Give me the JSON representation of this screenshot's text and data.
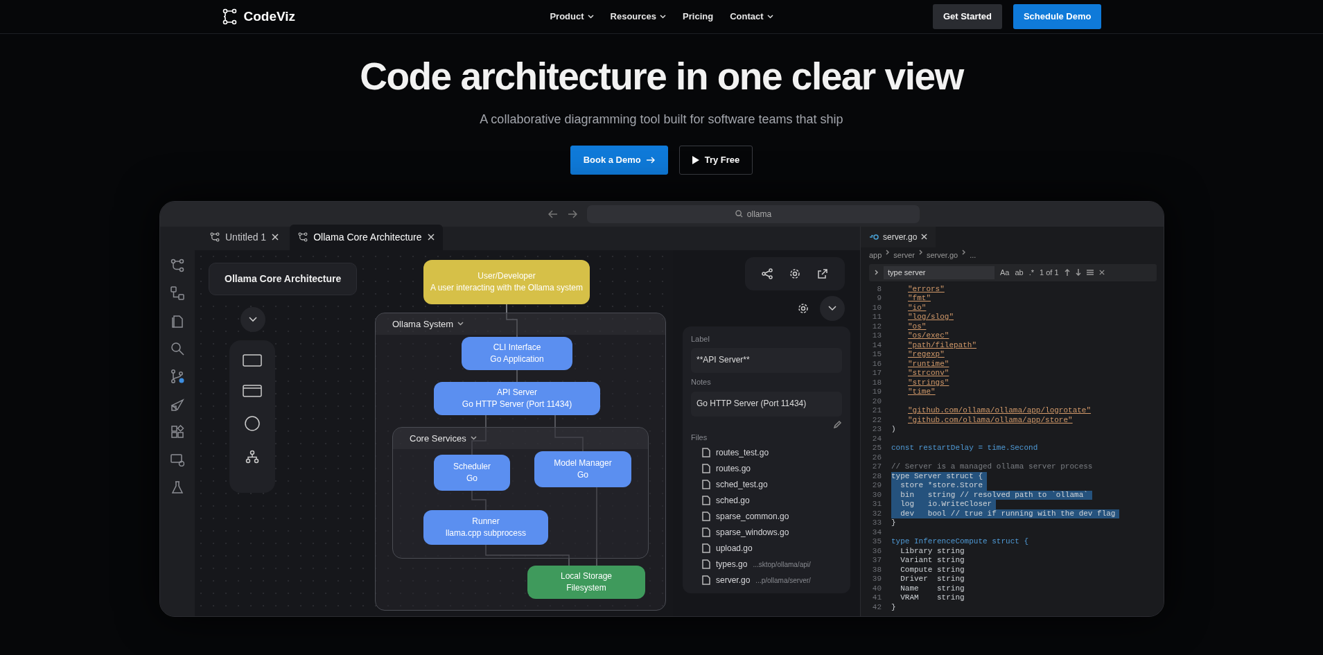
{
  "nav": {
    "brand": "CodeViz",
    "links": [
      {
        "label": "Product",
        "dropdown": true
      },
      {
        "label": "Resources",
        "dropdown": true
      },
      {
        "label": "Pricing",
        "dropdown": false
      },
      {
        "label": "Contact",
        "dropdown": true
      }
    ],
    "buttons": [
      {
        "label": "Get Started",
        "kind": "secondary"
      },
      {
        "label": "Schedule Demo",
        "kind": "primary"
      }
    ]
  },
  "hero": {
    "title": "Code architecture in one clear view",
    "subtitle": "A collaborative diagramming tool built for software teams that ship",
    "buttons": [
      {
        "label": "Book a Demo",
        "kind": "primary"
      },
      {
        "label": "Try Free",
        "kind": "outline"
      }
    ]
  },
  "app": {
    "search": "ollama",
    "tabs": [
      {
        "label": "Untitled 1",
        "selected": false
      },
      {
        "label": "Ollama Core Architecture",
        "selected": true
      }
    ],
    "diagram_title": "Ollama Core Architecture",
    "groups": [
      {
        "label": "Ollama System"
      },
      {
        "label": "Core Services"
      }
    ],
    "nodes": [
      {
        "title": "User/Developer",
        "subtitle": "A user interacting with the Ollama system",
        "color": "#d6c048"
      },
      {
        "title": "CLI Interface",
        "subtitle": "Go Application",
        "color": "#5b8ff0"
      },
      {
        "title": "API Server",
        "subtitle": "Go HTTP Server (Port 11434)",
        "color": "#5b8ff0"
      },
      {
        "title": "Scheduler",
        "subtitle": "Go",
        "color": "#5b8ff0"
      },
      {
        "title": "Model Manager",
        "subtitle": "Go",
        "color": "#5b8ff0"
      },
      {
        "title": "Runner",
        "subtitle": "llama.cpp subprocess",
        "color": "#5b8ff0"
      },
      {
        "title": "Local Storage",
        "subtitle": "Filesystem",
        "color": "#3f9a5c"
      }
    ],
    "properties": {
      "label_caption": "Label",
      "label_value": "**API Server**",
      "notes_caption": "Notes",
      "notes_value": "Go HTTP Server (Port 11434)",
      "files_caption": "Files",
      "files": [
        {
          "name": "routes_test.go"
        },
        {
          "name": "routes.go"
        },
        {
          "name": "sched_test.go"
        },
        {
          "name": "sched.go"
        },
        {
          "name": "sparse_common.go"
        },
        {
          "name": "sparse_windows.go"
        },
        {
          "name": "upload.go"
        },
        {
          "name": "types.go",
          "path": "...sktop/ollama/api/"
        },
        {
          "name": "server.go",
          "path": "...p/ollama/server/"
        }
      ]
    },
    "editor": {
      "tab": "server.go",
      "breadcrumb": [
        "app",
        "server",
        "server.go",
        "..."
      ],
      "find": "type server",
      "find_options": [
        "Aa",
        "ab",
        ".*"
      ],
      "find_count": "1 of 1",
      "lines": [
        {
          "n": "8",
          "code": "\"errors\"",
          "kind": "string",
          "highlighted": false
        },
        {
          "n": "9",
          "code": "\"fmt\"",
          "kind": "string",
          "highlighted": false
        },
        {
          "n": "10",
          "code": "\"io\"",
          "kind": "string",
          "highlighted": false
        },
        {
          "n": "11",
          "code": "\"log/slog\"",
          "kind": "string",
          "highlighted": false
        },
        {
          "n": "12",
          "code": "\"os\"",
          "kind": "string",
          "highlighted": false
        },
        {
          "n": "13",
          "code": "\"os/exec\"",
          "kind": "string",
          "highlighted": false
        },
        {
          "n": "14",
          "code": "\"path/filepath\"",
          "kind": "string",
          "highlighted": false
        },
        {
          "n": "15",
          "code": "\"regexp\"",
          "kind": "string",
          "highlighted": false
        },
        {
          "n": "16",
          "code": "\"runtime\"",
          "kind": "string",
          "highlighted": false
        },
        {
          "n": "17",
          "code": "\"strconv\"",
          "kind": "string",
          "highlighted": false
        },
        {
          "n": "18",
          "code": "\"strings\"",
          "kind": "string",
          "highlighted": false
        },
        {
          "n": "19",
          "code": "\"time\"",
          "kind": "string",
          "highlighted": false
        },
        {
          "n": "20",
          "highlighted": false
        },
        {
          "n": "21",
          "code": "\"github.com/ollama/ollama/app/logrotate\"",
          "kind": "string",
          "highlighted": false
        },
        {
          "n": "22",
          "code": "\"github.com/ollama/ollama/app/store\"",
          "kind": "string",
          "highlighted": false
        },
        {
          "n": "23",
          "code": ")",
          "kind": "plain",
          "highlighted": false
        },
        {
          "n": "24",
          "highlighted": false
        },
        {
          "n": "25",
          "code": "const restartDelay = time.Second",
          "kind": "keyword",
          "highlighted": false
        },
        {
          "n": "26",
          "highlighted": false
        },
        {
          "n": "27",
          "code": "// Server is a managed ollama server process",
          "kind": "comment",
          "highlighted": false
        },
        {
          "n": "28",
          "code": "type Server struct {",
          "kind": "plain",
          "highlighted": true
        },
        {
          "n": "29",
          "code": "  store *store.Store",
          "kind": "plain",
          "highlighted": true
        },
        {
          "n": "30",
          "code": "  bin   string // resolved path to `ollama`",
          "kind": "plain",
          "highlighted": true
        },
        {
          "n": "31",
          "code": "  log   io.WriteCloser",
          "kind": "plain",
          "highlighted": true
        },
        {
          "n": "32",
          "code": "  dev   bool // true if running with the dev flag",
          "kind": "plain",
          "highlighted": true
        },
        {
          "n": "33",
          "code": "}",
          "kind": "plain",
          "highlighted": false
        },
        {
          "n": "34",
          "highlighted": false
        },
        {
          "n": "35",
          "code": "type InferenceCompute struct {",
          "kind": "keyword",
          "highlighted": false
        },
        {
          "n": "36",
          "code": "  Library string",
          "kind": "plain",
          "highlighted": false
        },
        {
          "n": "37",
          "code": "  Variant string",
          "kind": "plain",
          "highlighted": false
        },
        {
          "n": "38",
          "code": "  Compute string",
          "kind": "plain",
          "highlighted": false
        },
        {
          "n": "39",
          "code": "  Driver  string",
          "kind": "plain",
          "highlighted": false
        },
        {
          "n": "40",
          "code": "  Name    string",
          "kind": "plain",
          "highlighted": false
        },
        {
          "n": "41",
          "code": "  VRAM    string",
          "kind": "plain",
          "highlighted": false
        },
        {
          "n": "42",
          "code": "}",
          "kind": "plain",
          "highlighted": false
        }
      ]
    }
  }
}
